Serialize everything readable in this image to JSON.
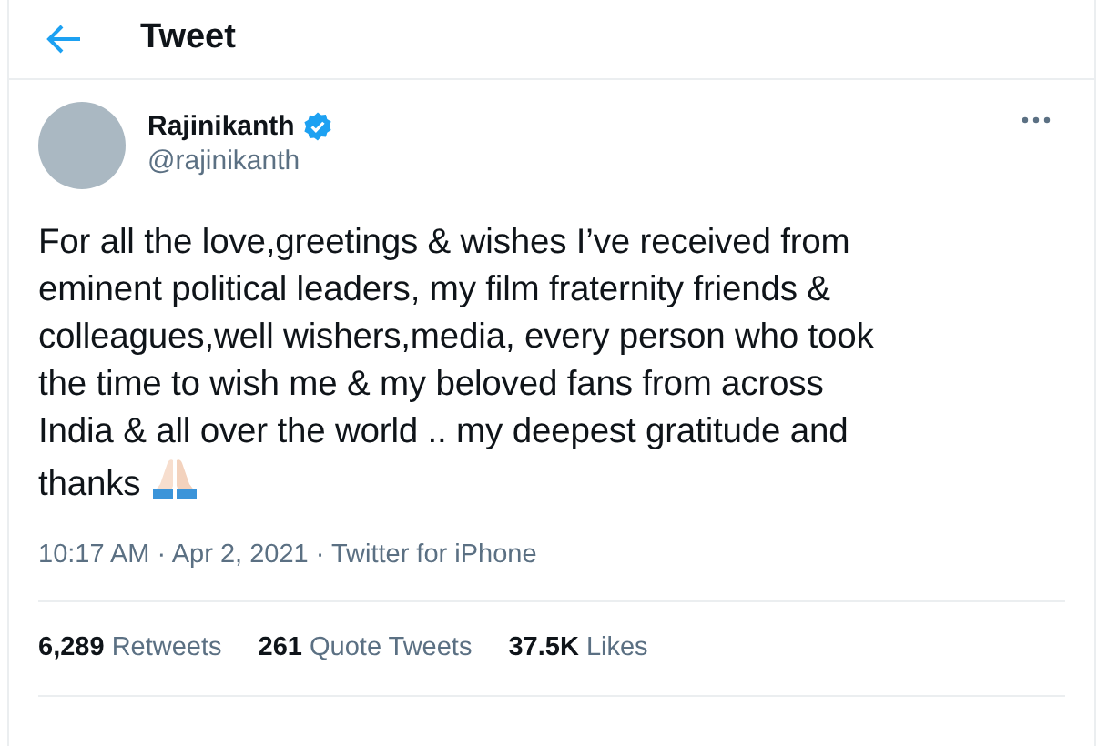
{
  "header": {
    "title": "Tweet"
  },
  "author": {
    "name": "Rajinikanth",
    "handle": "@rajinikanth",
    "verified": true
  },
  "tweet": {
    "lines": [
      "For all the love,greetings & wishes I’ve received from",
      "eminent political leaders, my film fraternity friends &",
      "colleagues,well wishers,media, every person who took",
      "the time to wish me & my beloved fans from across",
      "India & all over the world .. my deepest gratitude and",
      "thanks"
    ]
  },
  "meta": "10:17 AM · Apr 2, 2021 · Twitter for iPhone",
  "stats": [
    {
      "count": "6,289",
      "label": "Retweets"
    },
    {
      "count": "261",
      "label": "Quote Tweets"
    },
    {
      "count": "37.5K",
      "label": "Likes"
    }
  ]
}
